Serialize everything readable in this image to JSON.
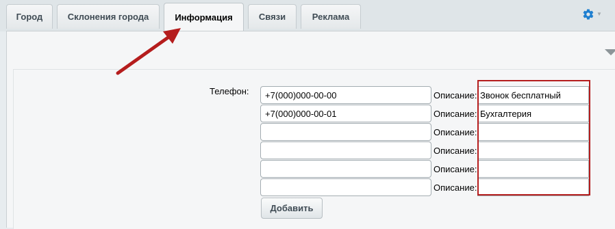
{
  "tabs": [
    {
      "label": "Город",
      "active": false
    },
    {
      "label": "Склонения города",
      "active": false
    },
    {
      "label": "Информация",
      "active": true
    },
    {
      "label": "Связи",
      "active": false
    },
    {
      "label": "Реклама",
      "active": false
    }
  ],
  "form": {
    "phone_label": "Телефон:",
    "description_label": "Описание:",
    "rows": [
      {
        "phone": "+7(000)000-00-00",
        "description": "Звонок бесплатный"
      },
      {
        "phone": "+7(000)000-00-01",
        "description": "Бухгалтерия"
      },
      {
        "phone": "",
        "description": ""
      },
      {
        "phone": "",
        "description": ""
      },
      {
        "phone": "",
        "description": ""
      },
      {
        "phone": "",
        "description": ""
      }
    ],
    "add_button_label": "Добавить"
  },
  "colors": {
    "annotation": "#b51d1d",
    "gear": "#1e7fd0"
  },
  "icons": {
    "settings": "gear-icon",
    "collapse": "triangle-down-icon"
  }
}
